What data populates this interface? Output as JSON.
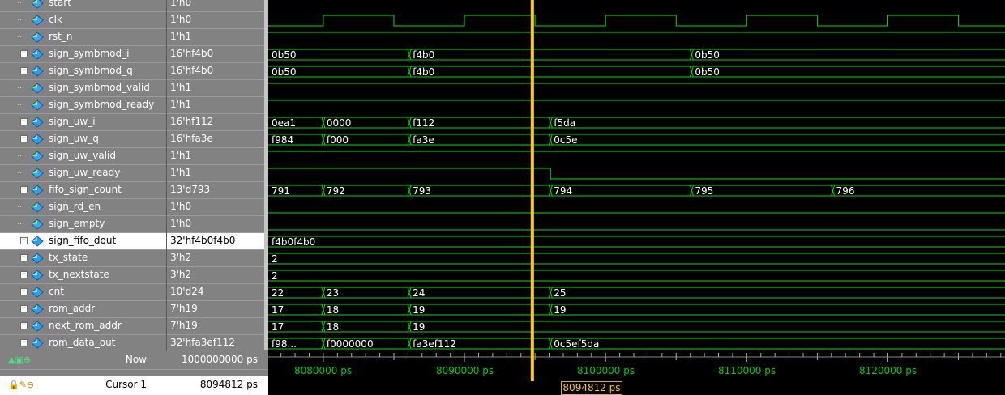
{
  "signals": [
    {
      "name": "start",
      "value": "1'h0",
      "bus": false
    },
    {
      "name": "clk",
      "value": "1'h0",
      "bus": false
    },
    {
      "name": "rst_n",
      "value": "1'h1",
      "bus": false
    },
    {
      "name": "sign_symbmod_i",
      "value": "16'hf4b0",
      "bus": true
    },
    {
      "name": "sign_symbmod_q",
      "value": "16'hf4b0",
      "bus": true
    },
    {
      "name": "sign_symbmod_valid",
      "value": "1'h1",
      "bus": false
    },
    {
      "name": "sign_symbmod_ready",
      "value": "1'h1",
      "bus": false
    },
    {
      "name": "sign_uw_i",
      "value": "16'hf112",
      "bus": true
    },
    {
      "name": "sign_uw_q",
      "value": "16'hfa3e",
      "bus": true
    },
    {
      "name": "sign_uw_valid",
      "value": "1'h1",
      "bus": false
    },
    {
      "name": "sign_uw_ready",
      "value": "1'h1",
      "bus": false
    },
    {
      "name": "fifo_sign_count",
      "value": "13'd793",
      "bus": true
    },
    {
      "name": "sign_rd_en",
      "value": "1'h0",
      "bus": false
    },
    {
      "name": "sign_empty",
      "value": "1'h0",
      "bus": false
    },
    {
      "name": "sign_fifo_dout",
      "value": "32'hf4b0f4b0",
      "bus": true,
      "selected": true
    },
    {
      "name": "tx_state",
      "value": "3'h2",
      "bus": true
    },
    {
      "name": "tx_nextstate",
      "value": "3'h2",
      "bus": true
    },
    {
      "name": "cnt",
      "value": "10'd24",
      "bus": true
    },
    {
      "name": "rom_addr",
      "value": "7'h19",
      "bus": true
    },
    {
      "name": "next_rom_addr",
      "value": "7'h19",
      "bus": true
    },
    {
      "name": "rom_data_out",
      "value": "32'hfa3ef112",
      "bus": true
    }
  ],
  "waves": [
    {
      "kind": "dashed"
    },
    {
      "kind": "clock"
    },
    {
      "kind": "high"
    },
    {
      "kind": "bus",
      "segs": [
        [
          "0b50",
          8076100
        ],
        [
          "f4b0",
          8086100
        ],
        [
          "0b50",
          8106100
        ]
      ]
    },
    {
      "kind": "bus",
      "segs": [
        [
          "0b50",
          8076100
        ],
        [
          "f4b0",
          8086100
        ],
        [
          "0b50",
          8106100
        ]
      ]
    },
    {
      "kind": "high"
    },
    {
      "kind": "high"
    },
    {
      "kind": "bus",
      "segs": [
        [
          "0ea1",
          8076100
        ],
        [
          "0000",
          8080000
        ],
        [
          "f112",
          8086100
        ],
        [
          "f5da",
          8096100
        ]
      ]
    },
    {
      "kind": "bus",
      "segs": [
        [
          "f984",
          8076100
        ],
        [
          "f000",
          8080000
        ],
        [
          "fa3e",
          8086100
        ],
        [
          "0c5e",
          8096100
        ]
      ]
    },
    {
      "kind": "high"
    },
    {
      "kind": "high_until",
      "t": 8096100
    },
    {
      "kind": "bus",
      "segs": [
        [
          "791",
          8076100
        ],
        [
          "792",
          8080000
        ],
        [
          "793",
          8086100
        ],
        [
          "794",
          8096100
        ],
        [
          "795",
          8106100
        ],
        [
          "796",
          8116100
        ]
      ]
    },
    {
      "kind": "low"
    },
    {
      "kind": "low"
    },
    {
      "kind": "bus",
      "segs": [
        [
          "f4b0f4b0",
          8076100
        ]
      ]
    },
    {
      "kind": "bus",
      "segs": [
        [
          "2",
          8076100
        ]
      ]
    },
    {
      "kind": "bus",
      "segs": [
        [
          "2",
          8076100
        ]
      ]
    },
    {
      "kind": "bus",
      "segs": [
        [
          "22",
          8076100
        ],
        [
          "23",
          8080000
        ],
        [
          "24",
          8086100
        ],
        [
          "25",
          8096100
        ]
      ]
    },
    {
      "kind": "bus",
      "segs": [
        [
          "17",
          8076100
        ],
        [
          "18",
          8080000
        ],
        [
          "19",
          8086100
        ],
        [
          "19",
          8096100
        ]
      ]
    },
    {
      "kind": "bus",
      "segs": [
        [
          "17",
          8076100
        ],
        [
          "18",
          8080000
        ],
        [
          "19",
          8086100
        ]
      ]
    },
    {
      "kind": "bus",
      "segs": [
        [
          "f98...",
          8076100
        ],
        [
          "f0000000",
          8080000
        ],
        [
          "fa3ef112",
          8086100
        ],
        [
          "0c5ef5da",
          8096100
        ]
      ]
    }
  ],
  "time_window": {
    "start": 8076100,
    "end": 8128300
  },
  "clock": {
    "period": 10000,
    "first_rise": 8080000
  },
  "cursor_time": 8094812,
  "timeline_ticks": [
    {
      "time": 8080000,
      "label": "8080000 ps"
    },
    {
      "time": 8090000,
      "label": "8090000 ps"
    },
    {
      "time": 8100000,
      "label": "8100000 ps"
    },
    {
      "time": 8110000,
      "label": "8110000 ps"
    },
    {
      "time": 8120000,
      "label": "8120000 ps"
    }
  ],
  "status": {
    "now_label": "Now",
    "now_value": "1000000000 ps",
    "cursor_label": "Cursor 1",
    "cursor_value": "8094812 ps",
    "cursor_flag": "8094812 ps"
  },
  "colors": {
    "wave": "#00e000",
    "cursor": "#ffcc00",
    "background": "#000000",
    "panel": "#828282"
  }
}
